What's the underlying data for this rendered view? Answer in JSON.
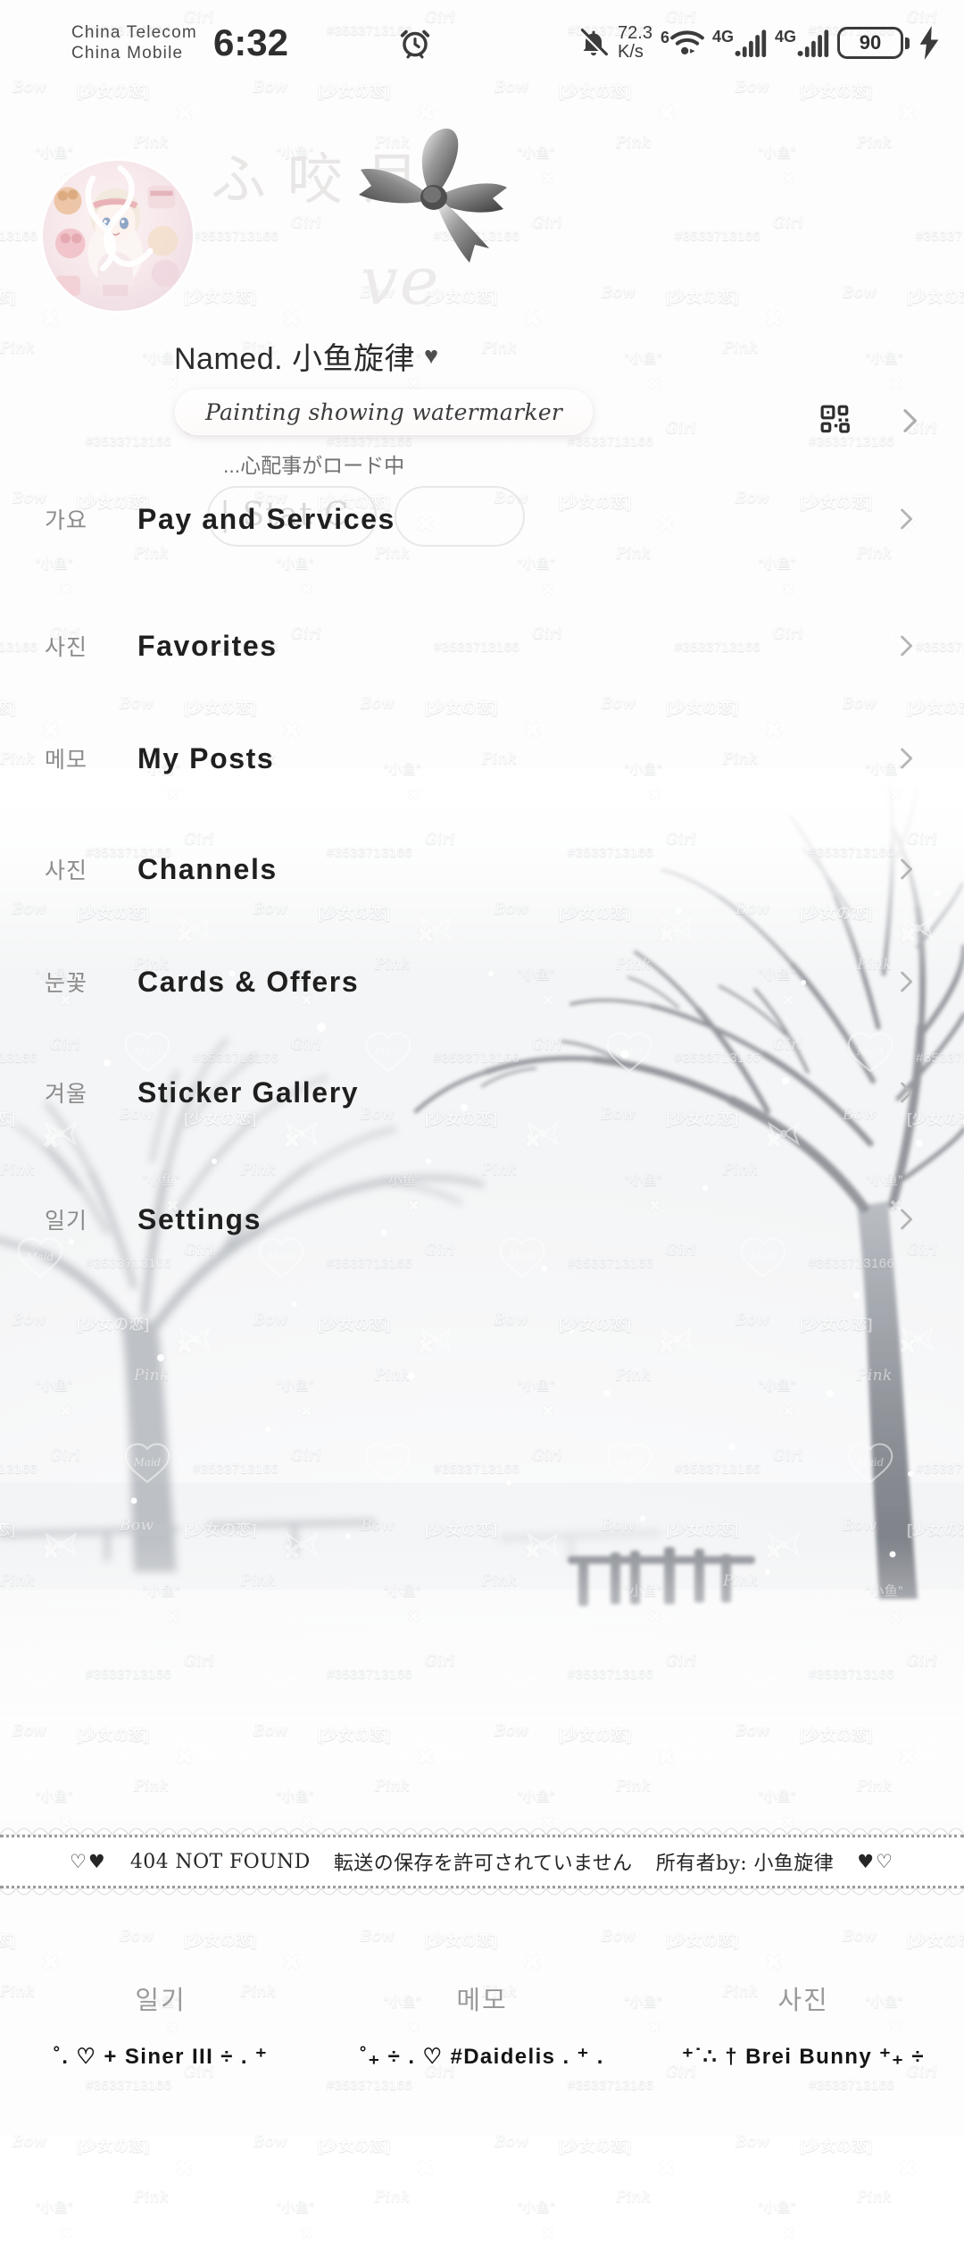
{
  "status_bar": {
    "carrier_line1": "China Telecom",
    "carrier_line2": "China Mobile",
    "time": "6:32",
    "alarm_icon": "alarm-clock-icon",
    "mute_icon": "bell-muted-icon",
    "net_speed_value": "72.3",
    "net_speed_unit": "K/s",
    "wifi_badge": "6",
    "wifi_icon": "wifi-icon",
    "signal1_label": "4G",
    "signal2_label": "4G",
    "battery_level": "90",
    "charging_icon": "lightning-bolt-icon"
  },
  "profile": {
    "ghost_kanji": "ふ 咬 月",
    "name": "Named. 小鱼旋律",
    "name_heart": "♥",
    "tagline": "Painting showing watermarker",
    "subtitle": "...心配事がロード中",
    "ghost_pill_text": "| Stat      C",
    "ghost_script": "ve",
    "qr_icon": "qr-code-icon",
    "chevron_icon": "chevron-right-icon",
    "avatar_icon": "avatar-anime-girl"
  },
  "menu": {
    "items": [
      {
        "kr": "가요",
        "label": "Pay and Services",
        "chevron": "chevron-right-icon"
      },
      {
        "kr": "사진",
        "label": "Favorites",
        "chevron": "chevron-right-icon"
      },
      {
        "kr": "메모",
        "label": "My Posts",
        "chevron": "chevron-right-icon"
      },
      {
        "kr": "사진",
        "label": "Channels",
        "chevron": "chevron-right-icon"
      },
      {
        "kr": "눈꽃",
        "label": "Cards & Offers",
        "chevron": "chevron-right-icon"
      },
      {
        "kr": "겨울",
        "label": "Sticker Gallery",
        "chevron": "chevron-right-icon"
      },
      {
        "kr": "일기",
        "label": "Settings",
        "chevron": "chevron-right-icon"
      }
    ]
  },
  "banner": {
    "hearts_left": "♡♥",
    "text1": "404 NOT FOUND",
    "text2": "転送の保存を許可されていません",
    "text3": "所有者by: 小鱼旋律",
    "hearts_right": "♥♡"
  },
  "footer": {
    "columns": [
      {
        "kr": "일기",
        "tag": "˚. ♡ + Siner III ÷ . ⁺"
      },
      {
        "kr": "메모",
        "tag": "˚₊ ÷ . ♡  #Daidelis  . ⁺ ."
      },
      {
        "kr": "사진",
        "tag": "⁺˙∴ † Brei Bunny ⁺₊ ÷"
      }
    ]
  },
  "watermark": {
    "tokens": [
      "Maid",
      "#3533713166",
      "[少女の恋]",
      "Bow",
      "Pink",
      "“小鱼”",
      "Girl"
    ]
  },
  "colors": {
    "page_bg": "#ffffff",
    "text_primary": "#1f1f1f",
    "text_muted": "#8b8b8b",
    "chevron": "#b5b5b5",
    "snow": "#f2f3f5",
    "tree": "#8d9096"
  }
}
